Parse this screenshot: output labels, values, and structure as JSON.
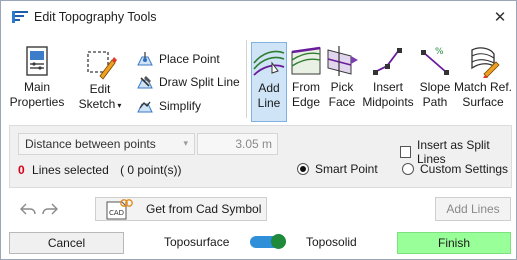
{
  "window": {
    "title": "Edit Topography Tools",
    "close_glyph": "✕"
  },
  "toolbar": {
    "main_properties": {
      "line1": "Main",
      "line2": "Properties",
      "icon": "properties-icon"
    },
    "edit_sketch": {
      "line1": "Edit",
      "line2": "Sketch",
      "caret": "▾",
      "icon": "edit-sketch-icon"
    },
    "place_point": {
      "label": "Place Point",
      "icon": "place-point-icon"
    },
    "draw_split_line": {
      "label": "Draw Split Line",
      "icon": "split-line-icon"
    },
    "simplify": {
      "label": "Simplify",
      "icon": "simplify-icon"
    },
    "add_line": {
      "line1": "Add",
      "line2": "Line",
      "icon": "add-line-icon",
      "active": true
    },
    "from_edge": {
      "line1": "From",
      "line2": "Edge",
      "icon": "from-edge-icon"
    },
    "pick_face": {
      "line1": "Pick",
      "line2": "Face",
      "icon": "pick-face-icon"
    },
    "insert_midpoints": {
      "line1": "Insert",
      "line2": "Midpoints",
      "icon": "insert-midpoints-icon"
    },
    "slope_path": {
      "line1": "Slope",
      "line2": "Path",
      "icon": "slope-path-icon"
    },
    "match_ref_surface": {
      "line1": "Match Ref.",
      "line2": "Surface",
      "icon": "match-surface-icon"
    }
  },
  "options": {
    "mode_select": {
      "value": "Distance between points",
      "chevron": "▾"
    },
    "distance_value": "3.05 m",
    "insert_as_split_lines": {
      "label": "Insert as Split Lines",
      "checked": false
    },
    "selection": {
      "count": "0",
      "text": "Lines selected",
      "points": "( 0 point(s))"
    },
    "smart_point": {
      "label": "Smart Point",
      "selected": true
    },
    "custom_settings": {
      "label": "Custom Settings",
      "selected": false
    }
  },
  "actions": {
    "undo_icon": "undo-arrow-icon",
    "redo_icon": "redo-arrow-icon",
    "cad_symbol_label": "Get from Cad Symbol",
    "cad_icon_text": "CAD",
    "add_lines_label": "Add Lines"
  },
  "footer": {
    "cancel_label": "Cancel",
    "toposurface_label": "Toposurface",
    "toposolid_label": "Toposolid",
    "toggle_state": "toposolid",
    "finish_label": "Finish"
  },
  "colors": {
    "selection_count": "#d9001b",
    "finish": "#99ff99",
    "toggle_track": "#2f8fd8",
    "toggle_knob": "#1e8a3a",
    "active_tool": "#cfe4f7"
  }
}
